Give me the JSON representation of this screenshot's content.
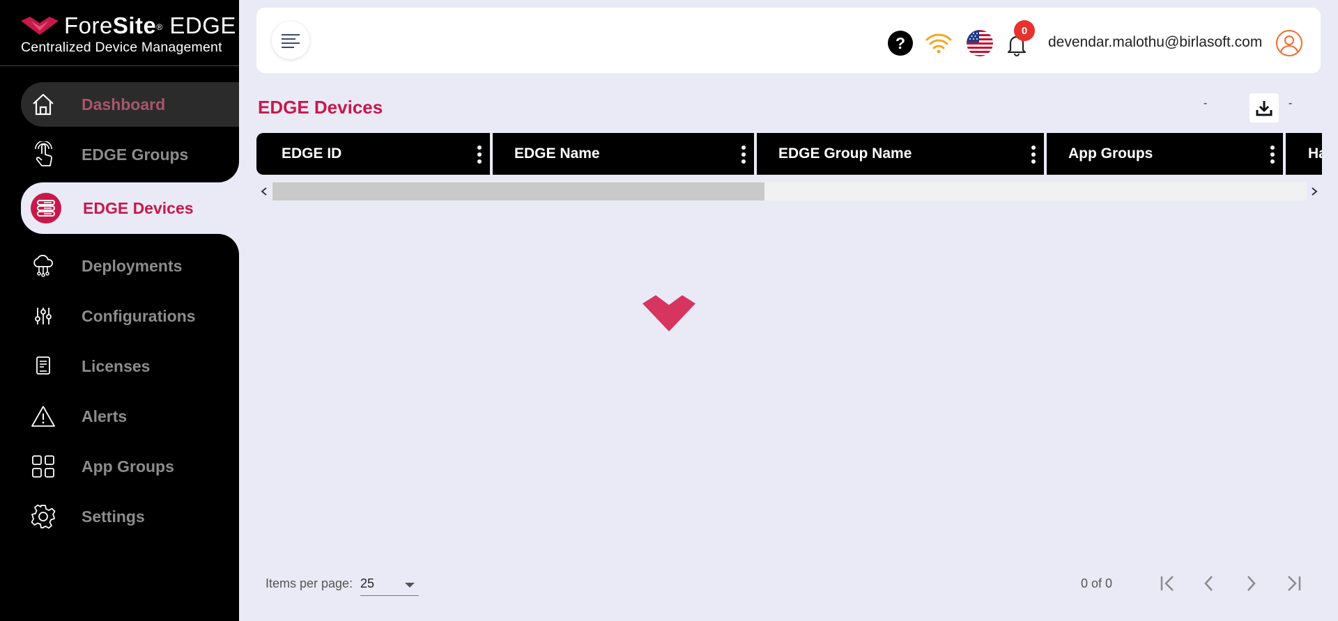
{
  "brand": {
    "name_light": "Fore",
    "name_bold": "Site",
    "registered": "®",
    "name_suffix": " EDGE",
    "subtitle": "Centralized Device Management",
    "accent_color": "#c8184a"
  },
  "sidebar": {
    "items": [
      {
        "label": "Dashboard",
        "icon": "home-icon",
        "state": "hovered"
      },
      {
        "label": "EDGE Groups",
        "icon": "touch-icon",
        "state": "normal"
      },
      {
        "label": "EDGE Devices",
        "icon": "server-icon",
        "state": "active"
      },
      {
        "label": "Deployments",
        "icon": "cloud-network-icon",
        "state": "normal"
      },
      {
        "label": "Configurations",
        "icon": "sliders-icon",
        "state": "normal"
      },
      {
        "label": "Licenses",
        "icon": "license-icon",
        "state": "normal"
      },
      {
        "label": "Alerts",
        "icon": "warning-icon",
        "state": "normal"
      },
      {
        "label": "App Groups",
        "icon": "grid-icon",
        "state": "normal"
      },
      {
        "label": "Settings",
        "icon": "gear-icon",
        "state": "normal"
      }
    ]
  },
  "header": {
    "menu_icon": "menu-icon",
    "help_symbol": "?",
    "notification_count": "0",
    "user_email": "devendar.malothu@birlasoft.com",
    "icons": [
      "help-icon",
      "wifi-icon",
      "us-flag-icon",
      "bell-icon",
      "user-avatar-icon"
    ]
  },
  "page": {
    "title": "EDGE Devices",
    "dash_left": "-",
    "dash_right": "-",
    "download_icon": "download-icon"
  },
  "table": {
    "columns": [
      "EDGE ID",
      "EDGE Name",
      "EDGE Group Name",
      "App Groups",
      "Ha"
    ],
    "rows": []
  },
  "paginator": {
    "items_per_page_label": "Items per page:",
    "items_per_page_value": "25",
    "range_label": "0 of 0"
  }
}
